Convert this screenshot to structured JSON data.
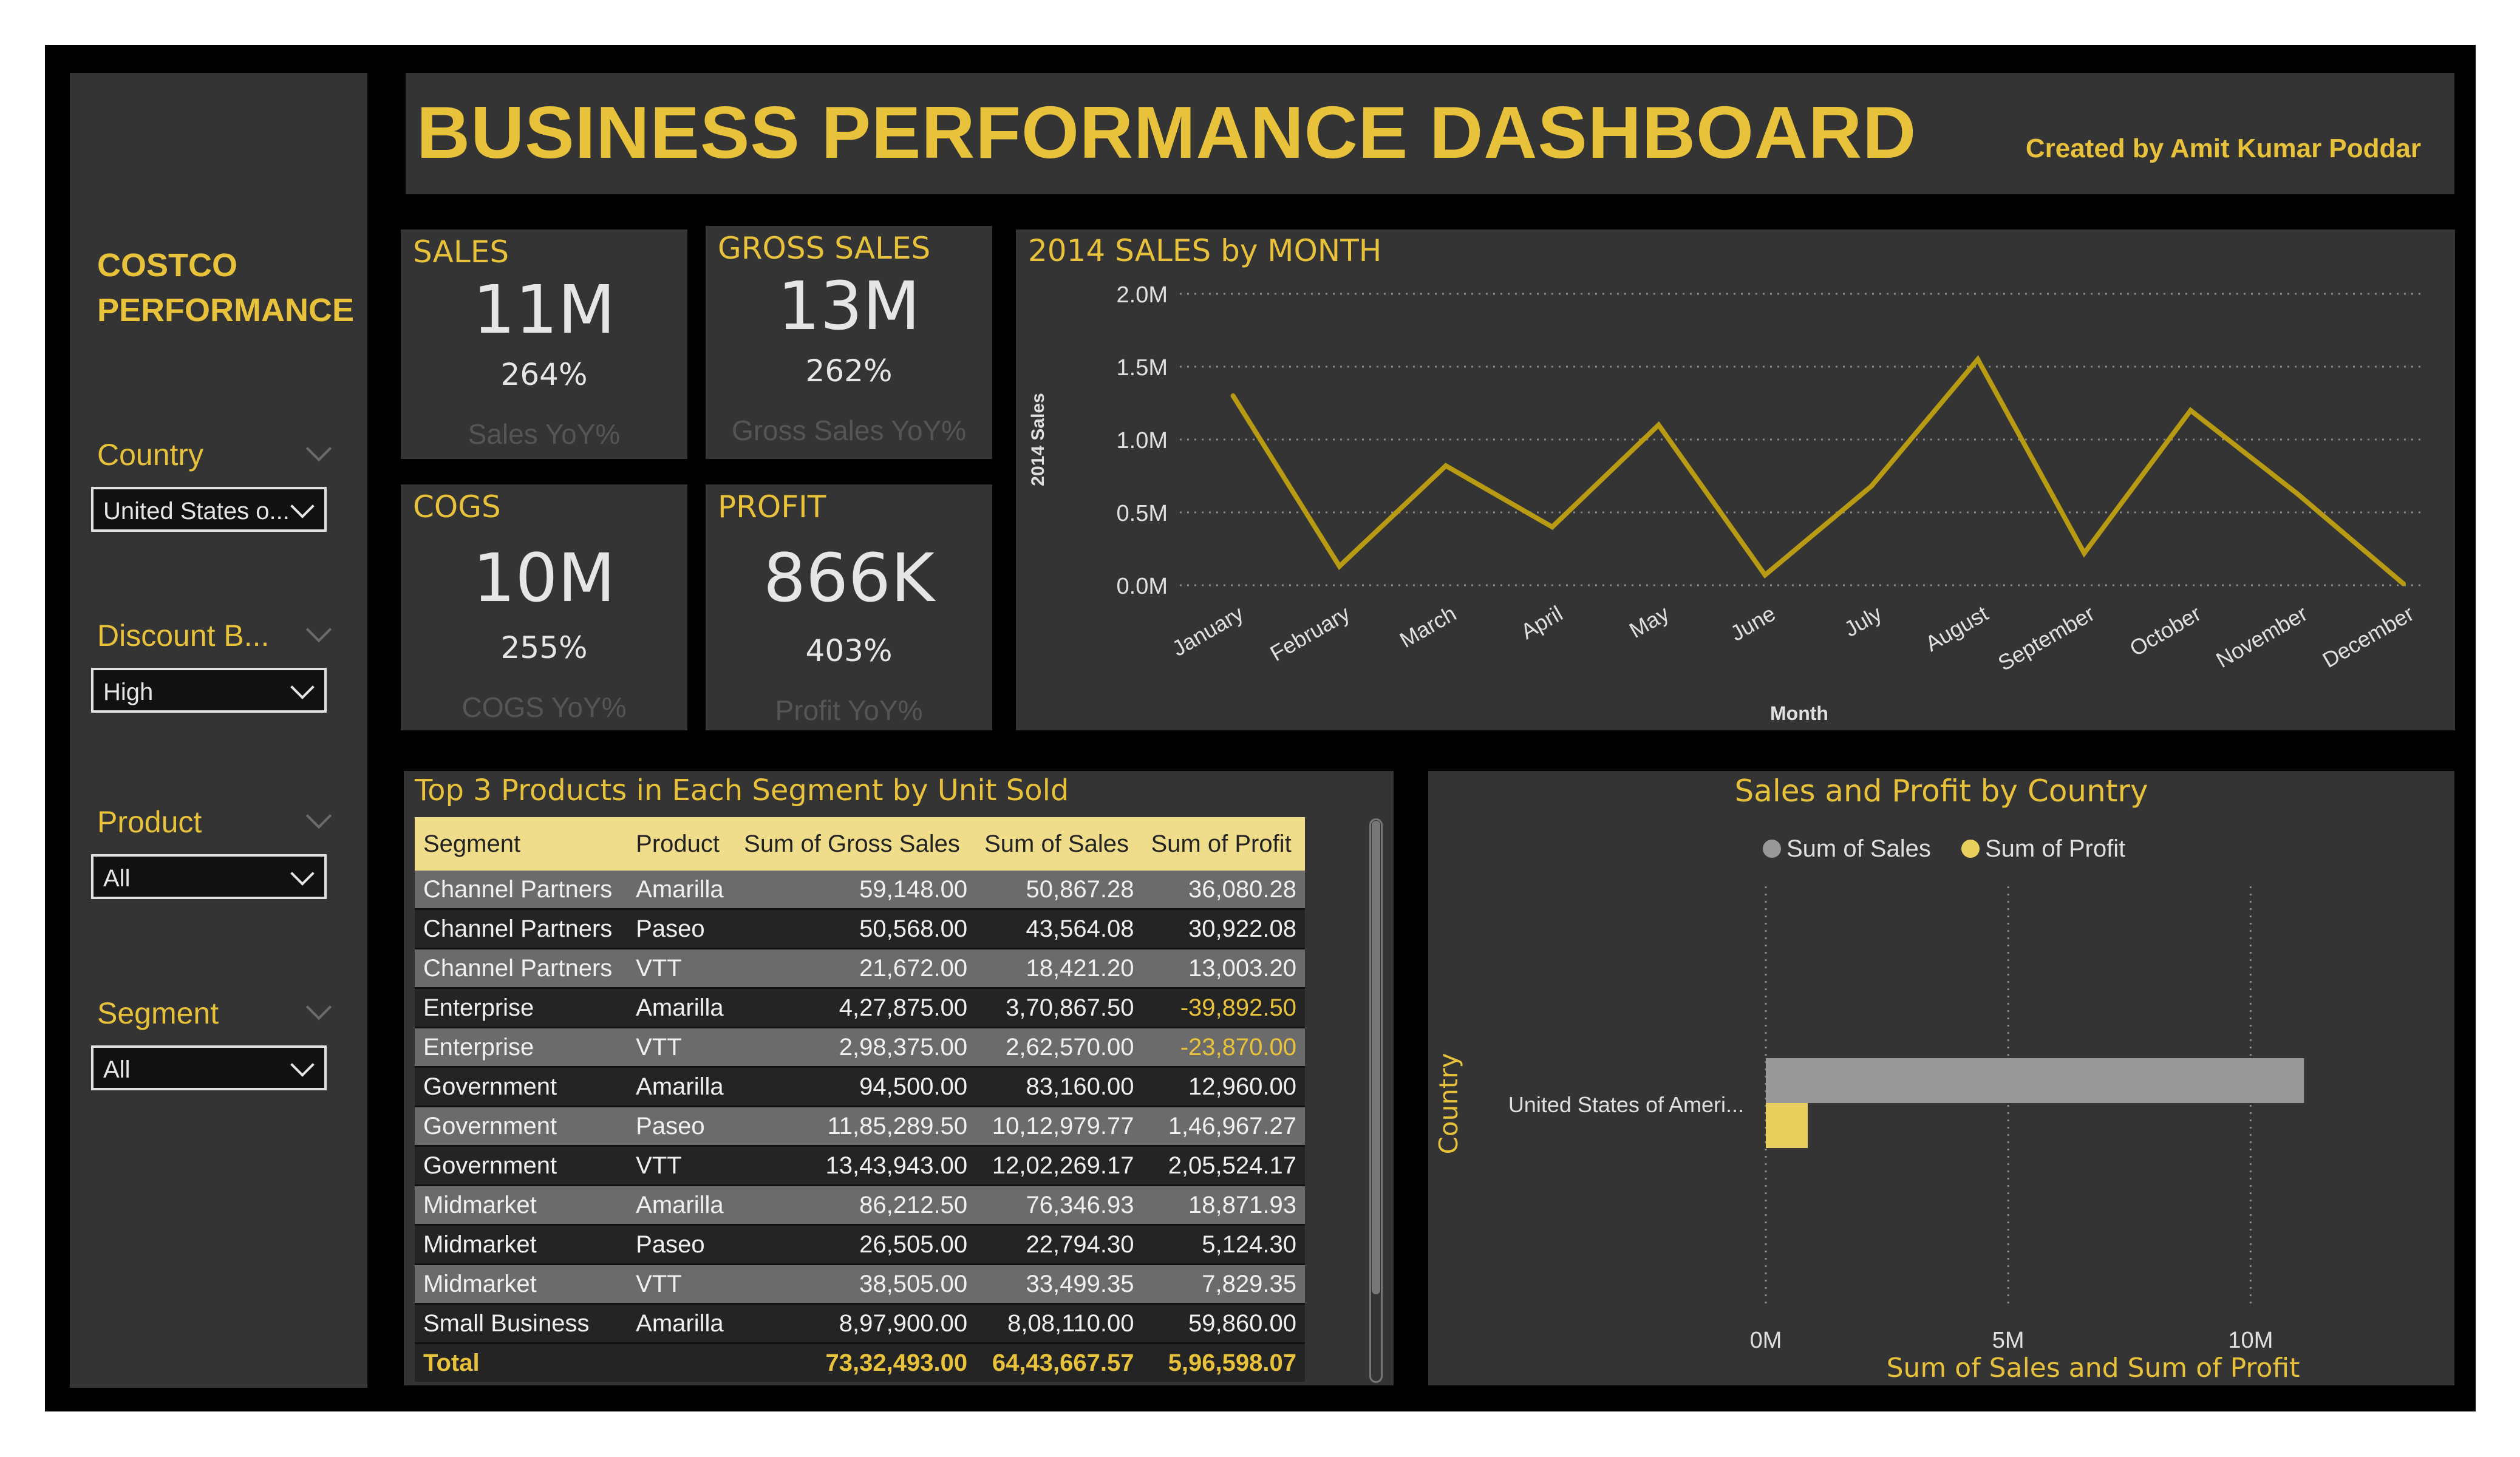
{
  "sidebar": {
    "brand_line1": "COSTCO",
    "brand_line2": "PERFORMANCE",
    "filters": [
      {
        "label": "Country",
        "value": "United States o..."
      },
      {
        "label": "Discount B...",
        "value": "High"
      },
      {
        "label": "Product",
        "value": "All"
      },
      {
        "label": "Segment",
        "value": "All"
      }
    ]
  },
  "header": {
    "title": "BUSINESS PERFORMANCE DASHBOARD",
    "credit": "Created by Amit Kumar Poddar"
  },
  "kpis": {
    "sales": {
      "label": "SALES",
      "value": "11M",
      "pct": "264%",
      "yoy": "Sales YoY%"
    },
    "gross_sales": {
      "label": "GROSS SALES",
      "value": "13M",
      "pct": "262%",
      "yoy": "Gross Sales YoY%"
    },
    "cogs": {
      "label": "COGS",
      "value": "10M",
      "pct": "255%",
      "yoy": "COGS YoY%"
    },
    "profit": {
      "label": "PROFIT",
      "value": "866K",
      "pct": "403%",
      "yoy": "Profit YoY%"
    }
  },
  "chart_data": [
    {
      "type": "line",
      "title": "2014 SALES by MONTH",
      "xlabel": "Month",
      "ylabel": "2014 Sales",
      "categories": [
        "January",
        "February",
        "March",
        "April",
        "May",
        "June",
        "July",
        "August",
        "September",
        "October",
        "November",
        "December"
      ],
      "values": [
        1.3,
        0.13,
        0.82,
        0.4,
        1.1,
        0.07,
        0.68,
        1.55,
        0.22,
        1.2,
        0.63,
        0.01
      ],
      "unit": "M",
      "ylim": [
        0,
        2.0
      ],
      "yticks": [
        "0.0M",
        "0.5M",
        "1.0M",
        "1.5M",
        "2.0M"
      ],
      "ytick_values": [
        0,
        0.5,
        1.0,
        1.5,
        2.0
      ],
      "line_color": "#b89b13",
      "grid": "dotted horizontal"
    },
    {
      "type": "bar",
      "orientation": "horizontal",
      "title": "Sales and Profit by Country",
      "xlabel": "Sum of Sales and Sum of Profit",
      "ylabel": "Country",
      "categories": [
        "United States of Ameri..."
      ],
      "series": [
        {
          "name": "Sum of  Sales",
          "values": [
            11.1
          ],
          "color": "#999999"
        },
        {
          "name": "Sum of Profit",
          "values": [
            0.866
          ],
          "color": "#e8cf5e"
        }
      ],
      "unit": "M",
      "xlim": [
        0,
        12.4
      ],
      "xticks": [
        "0M",
        "5M",
        "10M"
      ],
      "xtick_values": [
        0,
        5,
        10
      ],
      "legend_position": "top"
    }
  ],
  "table": {
    "title": "Top 3 Products in Each Segment by Unit Sold",
    "columns": [
      "Segment",
      "Product",
      "Sum of Gross Sales",
      "Sum of Sales",
      "Sum of Profit"
    ],
    "rows": [
      [
        "Channel Partners",
        "Amarilla",
        "59,148.00",
        "50,867.28",
        "36,080.28"
      ],
      [
        "Channel Partners",
        "Paseo",
        "50,568.00",
        "43,564.08",
        "30,922.08"
      ],
      [
        "Channel Partners",
        "VTT",
        "21,672.00",
        "18,421.20",
        "13,003.20"
      ],
      [
        "Enterprise",
        "Amarilla",
        "4,27,875.00",
        "3,70,867.50",
        "-39,892.50"
      ],
      [
        "Enterprise",
        "VTT",
        "2,98,375.00",
        "2,62,570.00",
        "-23,870.00"
      ],
      [
        "Government",
        "Amarilla",
        "94,500.00",
        "83,160.00",
        "12,960.00"
      ],
      [
        "Government",
        "Paseo",
        "11,85,289.50",
        "10,12,979.77",
        "1,46,967.27"
      ],
      [
        "Government",
        "VTT",
        "13,43,943.00",
        "12,02,269.17",
        "2,05,524.17"
      ],
      [
        "Midmarket",
        "Amarilla",
        "86,212.50",
        "76,346.93",
        "18,871.93"
      ],
      [
        "Midmarket",
        "Paseo",
        "26,505.00",
        "22,794.30",
        "5,124.30"
      ],
      [
        "Midmarket",
        "VTT",
        "38,505.00",
        "33,499.35",
        "7,829.35"
      ],
      [
        "Small Business",
        "Amarilla",
        "8,97,900.00",
        "8,08,110.00",
        "59,860.00"
      ]
    ],
    "total": [
      "Total",
      "",
      "73,32,493.00",
      "64,43,667.57",
      "5,96,598.07"
    ]
  }
}
